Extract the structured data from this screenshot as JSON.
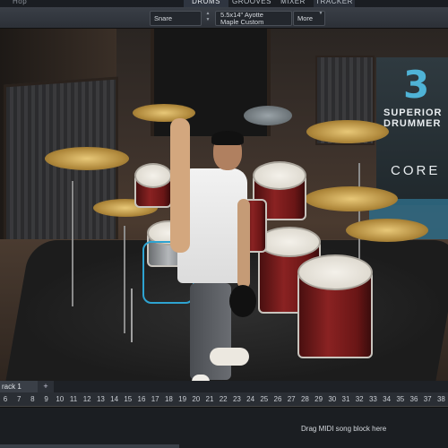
{
  "tabs": {
    "left": "Hop",
    "items": [
      "DRUMS",
      "GROOVES",
      "MIXER",
      "TRACKER"
    ],
    "active": "DRUMS"
  },
  "toolbar": {
    "instrument": "Snare",
    "model_line1": "5.5x14\" Ayotte",
    "model_line2": "Maple Custom",
    "more": "More"
  },
  "logo": {
    "number": "3",
    "line1": "SUPERIOR",
    "line2": "DRUMMER",
    "edition": "CORE",
    "accent": "#4fb3d6"
  },
  "song": {
    "tracks": [
      "rack 1"
    ],
    "add_label": "+",
    "bars": [
      "6",
      "7",
      "8",
      "9",
      "10",
      "11",
      "12",
      "13",
      "14",
      "15",
      "16",
      "17",
      "18",
      "19",
      "20",
      "21",
      "22",
      "23",
      "24",
      "25",
      "26",
      "27",
      "28",
      "29",
      "30",
      "31",
      "32",
      "33",
      "34",
      "35",
      "36",
      "37",
      "38"
    ],
    "drop_hint": "Drag MIDI song block here"
  }
}
